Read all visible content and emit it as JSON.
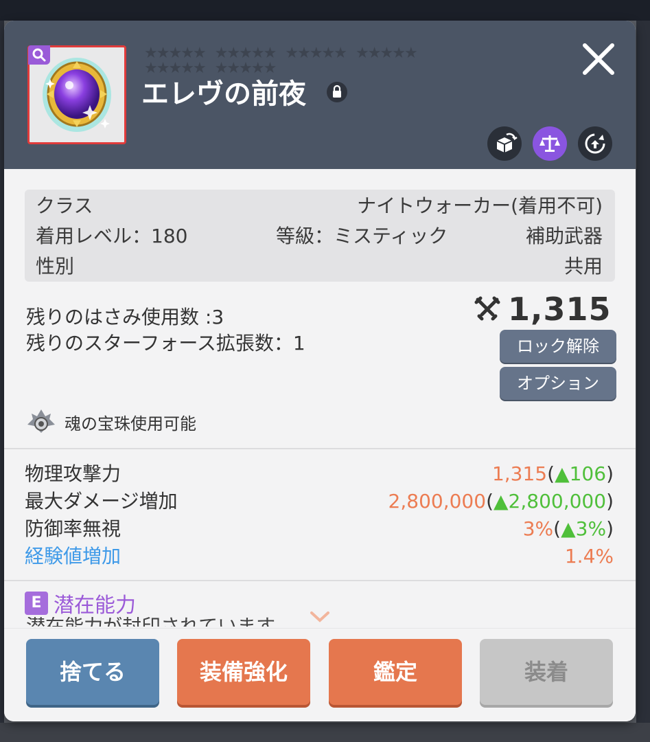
{
  "item": {
    "name": "エレヴの前夜",
    "star_char": "★"
  },
  "header_icons": [
    "share-icon",
    "compare-icon",
    "transfer-icon"
  ],
  "info": {
    "class_label": "クラス",
    "class_value": "ナイトウォーカー(着用不可)",
    "level_label": "着用レベル：180",
    "grade_label": "等級：ミスティック",
    "type_value": "補助武器",
    "gender_label": "性別",
    "gender_value": "共用"
  },
  "upgrades": {
    "scissors": "残りのはさみ使用数 :3",
    "starforce": "残りのスターフォース拡張数：1"
  },
  "combat_power": "1,315",
  "buttons_small": {
    "unlock": "ロック解除",
    "option": "オプション"
  },
  "soul": "魂の宝珠使用可能",
  "stats": [
    {
      "label": "物理攻撃力",
      "value": "1,315",
      "bonus": "106"
    },
    {
      "label": "最大ダメージ増加",
      "value": "2,800,000",
      "bonus": "2,800,000"
    },
    {
      "label": "防御率無視",
      "value": "3%",
      "bonus": "3%"
    },
    {
      "label": "経験値増加",
      "value": "1.4%"
    }
  ],
  "potential": {
    "badge": "E",
    "title": "潜在能力",
    "desc": "潜在能力が封印されています"
  },
  "actions": {
    "discard": "捨てる",
    "enhance": "装備強化",
    "appraise": "鑑定",
    "equip": "装着"
  },
  "colors": {
    "header_bg": "#4b5565",
    "stat_value": "#ec7c52",
    "stat_bonus": "#4fbf3a",
    "exp_label": "#3f9ae8",
    "potential": "#9b5ad8"
  }
}
